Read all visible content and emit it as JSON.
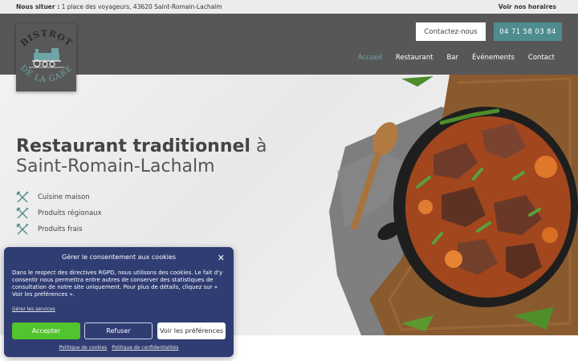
{
  "topbar": {
    "location_label": "Nous situer :",
    "address": "1 place des voyageurs, 43620 Saint-Romain-Lachalm",
    "hours_link": "Voir nos horaires"
  },
  "header": {
    "logo_top": "BISTROT",
    "logo_bottom": "DE LA GARE",
    "contact_button": "Contactez-nous",
    "phone_button": "04 71 58 03 84",
    "nav": [
      "Accueil",
      "Restaurant",
      "Bar",
      "Événements",
      "Contact"
    ],
    "active_nav": "Accueil"
  },
  "hero": {
    "title_bold": "Restaurant traditionnel",
    "title_rest": " à",
    "title_line2": "Saint-Romain-Lachalm",
    "features": [
      "Cuisine maison",
      "Produits régionaux",
      "Produits frais"
    ]
  },
  "cookie": {
    "title": "Gérer le consentement aux cookies",
    "close": "✕",
    "text": "Dans le respect des directives RGPD, nous utilisons des cookies. Le fait d'y consentir nous permettra entre autres de conserver des statistiques de consultation de notre site uniquement. Pour plus de détails, cliquez sur « Voir les préférences ».",
    "manage_link": "Gérer les services",
    "accept": "Accepter",
    "refuse": "Refuser",
    "preferences": "Voir les préférences",
    "policy_cookies": "Politique de cookies",
    "policy_privacy": "Politique de confidentialités"
  },
  "colors": {
    "header_bg": "#575757",
    "accent": "#4e8c8f",
    "cookie_bg": "#2f3d73",
    "accept_green": "#52c42d"
  }
}
